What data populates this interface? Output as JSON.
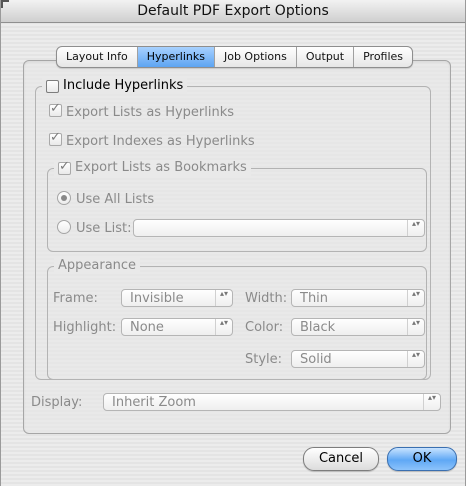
{
  "window": {
    "title": "Default PDF Export Options"
  },
  "tabs": [
    {
      "label": "Layout Info",
      "active": false
    },
    {
      "label": "Hyperlinks",
      "active": true
    },
    {
      "label": "Job Options",
      "active": false
    },
    {
      "label": "Output",
      "active": false
    },
    {
      "label": "Profiles",
      "active": false
    }
  ],
  "hyperlinks": {
    "include_label": "Include Hyperlinks",
    "include_checked": false,
    "export_lists_label": "Export Lists as Hyperlinks",
    "export_lists_checked": true,
    "export_indexes_label": "Export Indexes as Hyperlinks",
    "export_indexes_checked": true,
    "bookmarks": {
      "label": "Export Lists as Bookmarks",
      "checked": true,
      "use_all_label": "Use All Lists",
      "use_list_label": "Use List:",
      "use_list_value": "",
      "selected": "use_all"
    },
    "appearance": {
      "title": "Appearance",
      "frame_label": "Frame:",
      "frame_value": "Invisible",
      "width_label": "Width:",
      "width_value": "Thin",
      "highlight_label": "Highlight:",
      "highlight_value": "None",
      "color_label": "Color:",
      "color_value": "Black",
      "style_label": "Style:",
      "style_value": "Solid"
    },
    "display_label": "Display:",
    "display_value": "Inherit Zoom"
  },
  "buttons": {
    "cancel": "Cancel",
    "ok": "OK"
  },
  "glyphs": {
    "check": "✓",
    "updown": "▴▾"
  }
}
